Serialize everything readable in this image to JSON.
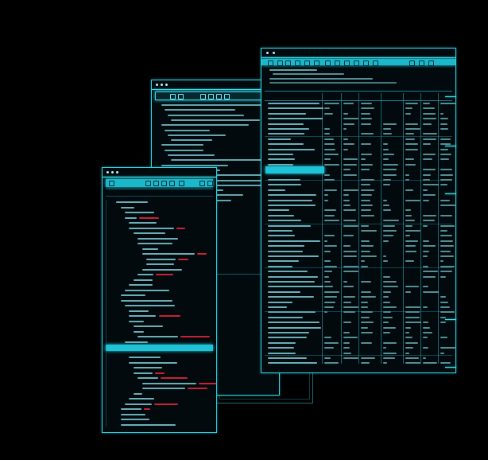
{
  "scene": {
    "background_color": "#000000",
    "accent_color": "#2fd4e6",
    "highlight_color": "#1ec3d8",
    "error_text_color": "#e0243a",
    "code_text_color": "#8fe6f2"
  },
  "windows": [
    {
      "name": "code-editor-window",
      "icons": [
        "window-dot-icon",
        "window-dot-icon",
        "window-dot-icon"
      ]
    },
    {
      "name": "text-editor-window",
      "icons": [
        "window-dot-icon",
        "window-dot-icon",
        "window-dot-icon"
      ]
    },
    {
      "name": "data-table-window",
      "icons": [
        "window-dot-icon",
        "window-dot-icon"
      ]
    }
  ]
}
